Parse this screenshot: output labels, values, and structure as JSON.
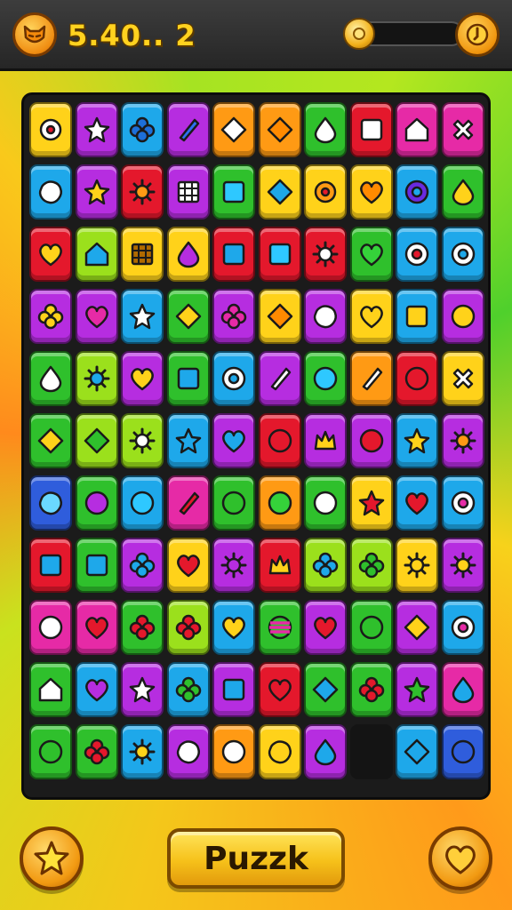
{
  "header": {
    "score": "5.40.. 2",
    "progress_fraction": 0.12
  },
  "icons": {
    "level_badge": "cat-face-icon",
    "coin": "coin-icon",
    "timer": "timer-icon",
    "star": "star-icon",
    "heart": "heart-icon"
  },
  "footer": {
    "play_label": "Puzzk"
  },
  "palette": {
    "yellow": "#ffd21a",
    "purple": "#b62de0",
    "blue": "#1ea8ea",
    "green": "#2fc02c",
    "lime": "#9be01c",
    "orange": "#ff9a14",
    "red": "#e4182c",
    "magenta": "#e62aa6",
    "navy": "#2f5ddc"
  },
  "board": {
    "rows": [
      [
        [
          "yellow",
          "flower",
          "#ffffff"
        ],
        [
          "purple",
          "star",
          "#ffffff"
        ],
        [
          "blue",
          "clover",
          "#1d6fd8"
        ],
        [
          "purple",
          "slash",
          "#2f6ff0"
        ],
        [
          "orange",
          "diamond",
          "#ffffff"
        ],
        [
          "orange",
          "diamond",
          "#ff8a00"
        ],
        [
          "green",
          "drop",
          "#ffffff"
        ],
        [
          "red",
          "square",
          "#ffffff"
        ],
        [
          "magenta",
          "house",
          "#ffffff"
        ],
        [
          "magenta",
          "cross",
          "#ffffff"
        ]
      ],
      [
        [
          "blue",
          "blob",
          "#ffffff"
        ],
        [
          "purple",
          "star",
          "#ffd21a"
        ],
        [
          "red",
          "sun",
          "#ff9a14"
        ],
        [
          "purple",
          "grid",
          "#ffffff"
        ],
        [
          "green",
          "square",
          "#2ec8ff"
        ],
        [
          "yellow",
          "diamond",
          "#1ea8ea"
        ],
        [
          "yellow",
          "flower",
          "#ff9a14"
        ],
        [
          "yellow",
          "heart",
          "#ff8a00"
        ],
        [
          "blue",
          "ring",
          "#6a2adf"
        ],
        [
          "green",
          "drop",
          "#ffd21a"
        ]
      ],
      [
        [
          "red",
          "heart",
          "#ffd21a"
        ],
        [
          "lime",
          "house",
          "#1ea8ea"
        ],
        [
          "yellow",
          "grid",
          "#b06a00"
        ],
        [
          "yellow",
          "drop",
          "#b62de0"
        ],
        [
          "red",
          "square",
          "#1ea8ea"
        ],
        [
          "red",
          "square",
          "#2ec8ff"
        ],
        [
          "red",
          "sun",
          "#ffffff"
        ],
        [
          "green",
          "heart",
          "#35d23a"
        ],
        [
          "blue",
          "target",
          "#e4182c"
        ],
        [
          "blue",
          "target",
          "#1ea8ea"
        ]
      ],
      [
        [
          "purple",
          "clover",
          "#ffd21a"
        ],
        [
          "purple",
          "heart",
          "#e62aa6"
        ],
        [
          "blue",
          "star",
          "#ffffff"
        ],
        [
          "green",
          "diamond",
          "#ffd21a"
        ],
        [
          "purple",
          "clover",
          "#e62aa6"
        ],
        [
          "yellow",
          "diamond",
          "#ff8a00"
        ],
        [
          "purple",
          "blob",
          "#ffffff"
        ],
        [
          "yellow",
          "heart",
          "#ffd21a"
        ],
        [
          "blue",
          "square",
          "#ffd21a"
        ],
        [
          "purple",
          "circle",
          "#ffd21a"
        ]
      ],
      [
        [
          "green",
          "drop",
          "#ffffff"
        ],
        [
          "lime",
          "sun",
          "#1ea8ea"
        ],
        [
          "purple",
          "heart",
          "#ffd21a"
        ],
        [
          "green",
          "square",
          "#1ea8ea"
        ],
        [
          "blue",
          "ring",
          "#ffffff"
        ],
        [
          "purple",
          "slash",
          "#ffffff"
        ],
        [
          "green",
          "circle",
          "#2ec8ff"
        ],
        [
          "orange",
          "slash",
          "#ffffff"
        ],
        [
          "red",
          "circle",
          "#e4182c"
        ],
        [
          "yellow",
          "cross",
          "#ffffff"
        ]
      ],
      [
        [
          "green",
          "diamond",
          "#ffd21a"
        ],
        [
          "lime",
          "diamond",
          "#2fc02c"
        ],
        [
          "lime",
          "sun",
          "#ffffff"
        ],
        [
          "blue",
          "star",
          "#1ea8ea"
        ],
        [
          "purple",
          "heart",
          "#1ea8ea"
        ],
        [
          "red",
          "circle",
          "#e4182c"
        ],
        [
          "purple",
          "crown",
          "#ffd21a"
        ],
        [
          "purple",
          "circle",
          "#e4182c"
        ],
        [
          "blue",
          "star",
          "#ffd21a"
        ],
        [
          "purple",
          "sun",
          "#ff9a14"
        ]
      ],
      [
        [
          "navy",
          "blob",
          "#6ad8ff"
        ],
        [
          "green",
          "circle",
          "#b62de0"
        ],
        [
          "blue",
          "circle",
          "#2ec8ff"
        ],
        [
          "magenta",
          "slash",
          "#e4182c"
        ],
        [
          "green",
          "circle",
          "#2fc02c"
        ],
        [
          "orange",
          "circle",
          "#35d23a"
        ],
        [
          "green",
          "circle",
          "#ffffff"
        ],
        [
          "yellow",
          "star",
          "#e4182c"
        ],
        [
          "blue",
          "heart",
          "#e4182c"
        ],
        [
          "blue",
          "target",
          "#e62aa6"
        ]
      ],
      [
        [
          "red",
          "square",
          "#1ea8ea"
        ],
        [
          "green",
          "square",
          "#1ea8ea"
        ],
        [
          "purple",
          "clover",
          "#1ea8ea"
        ],
        [
          "yellow",
          "heart",
          "#e4182c"
        ],
        [
          "purple",
          "sun",
          "#b62de0"
        ],
        [
          "red",
          "crown",
          "#ffd21a"
        ],
        [
          "lime",
          "clover",
          "#1ea8ea"
        ],
        [
          "lime",
          "clover",
          "#2fc02c"
        ],
        [
          "yellow",
          "sun",
          "#ffd21a"
        ],
        [
          "purple",
          "sun",
          "#ffd21a"
        ]
      ],
      [
        [
          "magenta",
          "circle",
          "#ffffff"
        ],
        [
          "magenta",
          "heart",
          "#e4182c"
        ],
        [
          "green",
          "clover",
          "#e4182c"
        ],
        [
          "lime",
          "clover",
          "#e4182c"
        ],
        [
          "blue",
          "heart",
          "#ffd21a"
        ],
        [
          "green",
          "stripes",
          "#e62aa6"
        ],
        [
          "purple",
          "heart",
          "#e4182c"
        ],
        [
          "green",
          "circle",
          "#2fc02c"
        ],
        [
          "purple",
          "diamond",
          "#ffd21a"
        ],
        [
          "blue",
          "target",
          "#e62aa6"
        ]
      ],
      [
        [
          "green",
          "house",
          "#ffffff"
        ],
        [
          "blue",
          "heart",
          "#b62de0"
        ],
        [
          "purple",
          "star",
          "#ffffff"
        ],
        [
          "blue",
          "clover",
          "#2fc02c"
        ],
        [
          "purple",
          "square",
          "#1ea8ea"
        ],
        [
          "red",
          "heart",
          "#e4182c"
        ],
        [
          "green",
          "diamond",
          "#1ea8ea"
        ],
        [
          "green",
          "clover",
          "#e4182c"
        ],
        [
          "purple",
          "star",
          "#2fc02c"
        ],
        [
          "magenta",
          "drop",
          "#1ea8ea"
        ]
      ],
      [
        [
          "green",
          "circle",
          "#2fc02c"
        ],
        [
          "green",
          "clover",
          "#e4182c"
        ],
        [
          "blue",
          "sun",
          "#ffd21a"
        ],
        [
          "purple",
          "blob",
          "#ffffff"
        ],
        [
          "orange",
          "circle",
          "#ffffff"
        ],
        [
          "yellow",
          "blob",
          "#ffd21a"
        ],
        [
          "purple",
          "drop",
          "#1ea8ea"
        ],
        [
          "none",
          "none",
          "#000000"
        ],
        [
          "blue",
          "diamond",
          "#1ea8ea"
        ],
        [
          "navy",
          "circle",
          "#2f5ddc"
        ]
      ]
    ]
  }
}
